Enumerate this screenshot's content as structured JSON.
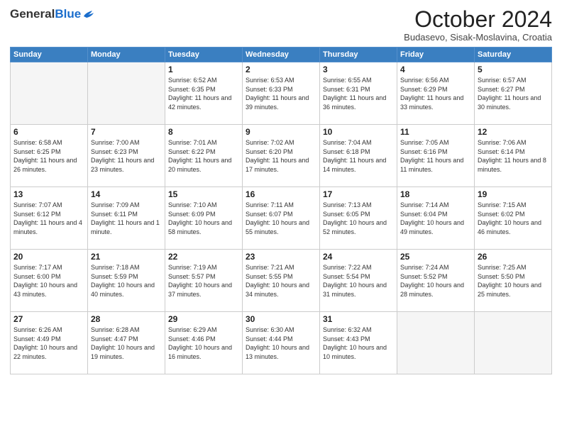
{
  "header": {
    "logo": {
      "general": "General",
      "blue": "Blue"
    },
    "title": "October 2024",
    "location": "Budasevo, Sisak-Moslavina, Croatia"
  },
  "weekdays": [
    "Sunday",
    "Monday",
    "Tuesday",
    "Wednesday",
    "Thursday",
    "Friday",
    "Saturday"
  ],
  "weeks": [
    [
      {
        "day": "",
        "empty": true
      },
      {
        "day": "",
        "empty": true
      },
      {
        "day": "1",
        "sunrise": "6:52 AM",
        "sunset": "6:35 PM",
        "daylight": "11 hours and 42 minutes."
      },
      {
        "day": "2",
        "sunrise": "6:53 AM",
        "sunset": "6:33 PM",
        "daylight": "11 hours and 39 minutes."
      },
      {
        "day": "3",
        "sunrise": "6:55 AM",
        "sunset": "6:31 PM",
        "daylight": "11 hours and 36 minutes."
      },
      {
        "day": "4",
        "sunrise": "6:56 AM",
        "sunset": "6:29 PM",
        "daylight": "11 hours and 33 minutes."
      },
      {
        "day": "5",
        "sunrise": "6:57 AM",
        "sunset": "6:27 PM",
        "daylight": "11 hours and 30 minutes."
      }
    ],
    [
      {
        "day": "6",
        "sunrise": "6:58 AM",
        "sunset": "6:25 PM",
        "daylight": "11 hours and 26 minutes."
      },
      {
        "day": "7",
        "sunrise": "7:00 AM",
        "sunset": "6:23 PM",
        "daylight": "11 hours and 23 minutes."
      },
      {
        "day": "8",
        "sunrise": "7:01 AM",
        "sunset": "6:22 PM",
        "daylight": "11 hours and 20 minutes."
      },
      {
        "day": "9",
        "sunrise": "7:02 AM",
        "sunset": "6:20 PM",
        "daylight": "11 hours and 17 minutes."
      },
      {
        "day": "10",
        "sunrise": "7:04 AM",
        "sunset": "6:18 PM",
        "daylight": "11 hours and 14 minutes."
      },
      {
        "day": "11",
        "sunrise": "7:05 AM",
        "sunset": "6:16 PM",
        "daylight": "11 hours and 11 minutes."
      },
      {
        "day": "12",
        "sunrise": "7:06 AM",
        "sunset": "6:14 PM",
        "daylight": "11 hours and 8 minutes."
      }
    ],
    [
      {
        "day": "13",
        "sunrise": "7:07 AM",
        "sunset": "6:12 PM",
        "daylight": "11 hours and 4 minutes."
      },
      {
        "day": "14",
        "sunrise": "7:09 AM",
        "sunset": "6:11 PM",
        "daylight": "11 hours and 1 minute."
      },
      {
        "day": "15",
        "sunrise": "7:10 AM",
        "sunset": "6:09 PM",
        "daylight": "10 hours and 58 minutes."
      },
      {
        "day": "16",
        "sunrise": "7:11 AM",
        "sunset": "6:07 PM",
        "daylight": "10 hours and 55 minutes."
      },
      {
        "day": "17",
        "sunrise": "7:13 AM",
        "sunset": "6:05 PM",
        "daylight": "10 hours and 52 minutes."
      },
      {
        "day": "18",
        "sunrise": "7:14 AM",
        "sunset": "6:04 PM",
        "daylight": "10 hours and 49 minutes."
      },
      {
        "day": "19",
        "sunrise": "7:15 AM",
        "sunset": "6:02 PM",
        "daylight": "10 hours and 46 minutes."
      }
    ],
    [
      {
        "day": "20",
        "sunrise": "7:17 AM",
        "sunset": "6:00 PM",
        "daylight": "10 hours and 43 minutes."
      },
      {
        "day": "21",
        "sunrise": "7:18 AM",
        "sunset": "5:59 PM",
        "daylight": "10 hours and 40 minutes."
      },
      {
        "day": "22",
        "sunrise": "7:19 AM",
        "sunset": "5:57 PM",
        "daylight": "10 hours and 37 minutes."
      },
      {
        "day": "23",
        "sunrise": "7:21 AM",
        "sunset": "5:55 PM",
        "daylight": "10 hours and 34 minutes."
      },
      {
        "day": "24",
        "sunrise": "7:22 AM",
        "sunset": "5:54 PM",
        "daylight": "10 hours and 31 minutes."
      },
      {
        "day": "25",
        "sunrise": "7:24 AM",
        "sunset": "5:52 PM",
        "daylight": "10 hours and 28 minutes."
      },
      {
        "day": "26",
        "sunrise": "7:25 AM",
        "sunset": "5:50 PM",
        "daylight": "10 hours and 25 minutes."
      }
    ],
    [
      {
        "day": "27",
        "sunrise": "6:26 AM",
        "sunset": "4:49 PM",
        "daylight": "10 hours and 22 minutes."
      },
      {
        "day": "28",
        "sunrise": "6:28 AM",
        "sunset": "4:47 PM",
        "daylight": "10 hours and 19 minutes."
      },
      {
        "day": "29",
        "sunrise": "6:29 AM",
        "sunset": "4:46 PM",
        "daylight": "10 hours and 16 minutes."
      },
      {
        "day": "30",
        "sunrise": "6:30 AM",
        "sunset": "4:44 PM",
        "daylight": "10 hours and 13 minutes."
      },
      {
        "day": "31",
        "sunrise": "6:32 AM",
        "sunset": "4:43 PM",
        "daylight": "10 hours and 10 minutes."
      },
      {
        "day": "",
        "empty": true
      },
      {
        "day": "",
        "empty": true
      }
    ]
  ]
}
